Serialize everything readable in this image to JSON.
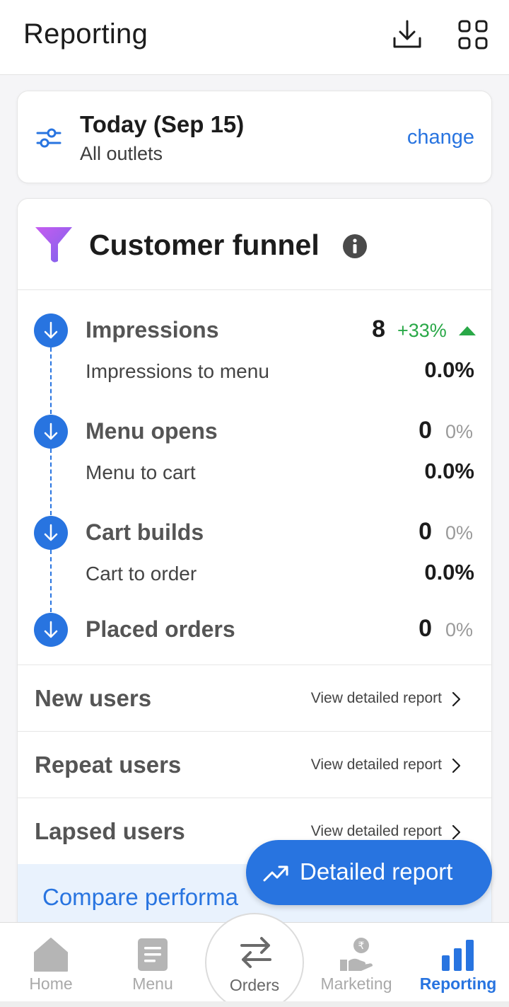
{
  "header": {
    "title": "Reporting",
    "download_icon": "download-icon",
    "grid_icon": "grid-icon"
  },
  "filter": {
    "date_label": "Today (Sep 15)",
    "outlet_label": "All outlets",
    "change_label": "change",
    "icon": "sliders-icon"
  },
  "funnel": {
    "title": "Customer funnel",
    "info_icon": "info-icon",
    "accent_color": "#2874e0",
    "steps": [
      {
        "label": "Impressions",
        "count": "8",
        "change": "+33%",
        "trend": "up"
      },
      {
        "label": "Menu opens",
        "count": "0",
        "change": "0%"
      },
      {
        "label": "Cart builds",
        "count": "0",
        "change": "0%"
      },
      {
        "label": "Placed orders",
        "count": "0",
        "change": "0%"
      }
    ],
    "conversions": [
      {
        "label": "Impressions to menu",
        "value": "0.0%"
      },
      {
        "label": "Menu to cart",
        "value": "0.0%"
      },
      {
        "label": "Cart to order",
        "value": "0.0%"
      }
    ]
  },
  "user_rows": [
    {
      "label": "New users",
      "link": "View detailed report"
    },
    {
      "label": "Repeat users",
      "link": "View detailed report"
    },
    {
      "label": "Lapsed users",
      "link": "View detailed report"
    }
  ],
  "compare": {
    "label": "Compare performa"
  },
  "fab": {
    "label": "Detailed report",
    "icon": "trending-up-icon"
  },
  "bottom_nav": [
    {
      "label": "Home",
      "icon": "home-icon",
      "active": false
    },
    {
      "label": "Menu",
      "icon": "menu-doc-icon",
      "active": false
    },
    {
      "label": "Orders",
      "icon": "swap-arrows-icon",
      "active": false
    },
    {
      "label": "Marketing",
      "icon": "rupee-hand-icon",
      "active": false
    },
    {
      "label": "Reporting",
      "icon": "bar-chart-icon",
      "active": true
    }
  ],
  "colors": {
    "brand": "#2874e0",
    "positive": "#29a847",
    "muted": "#9a9a9a"
  }
}
